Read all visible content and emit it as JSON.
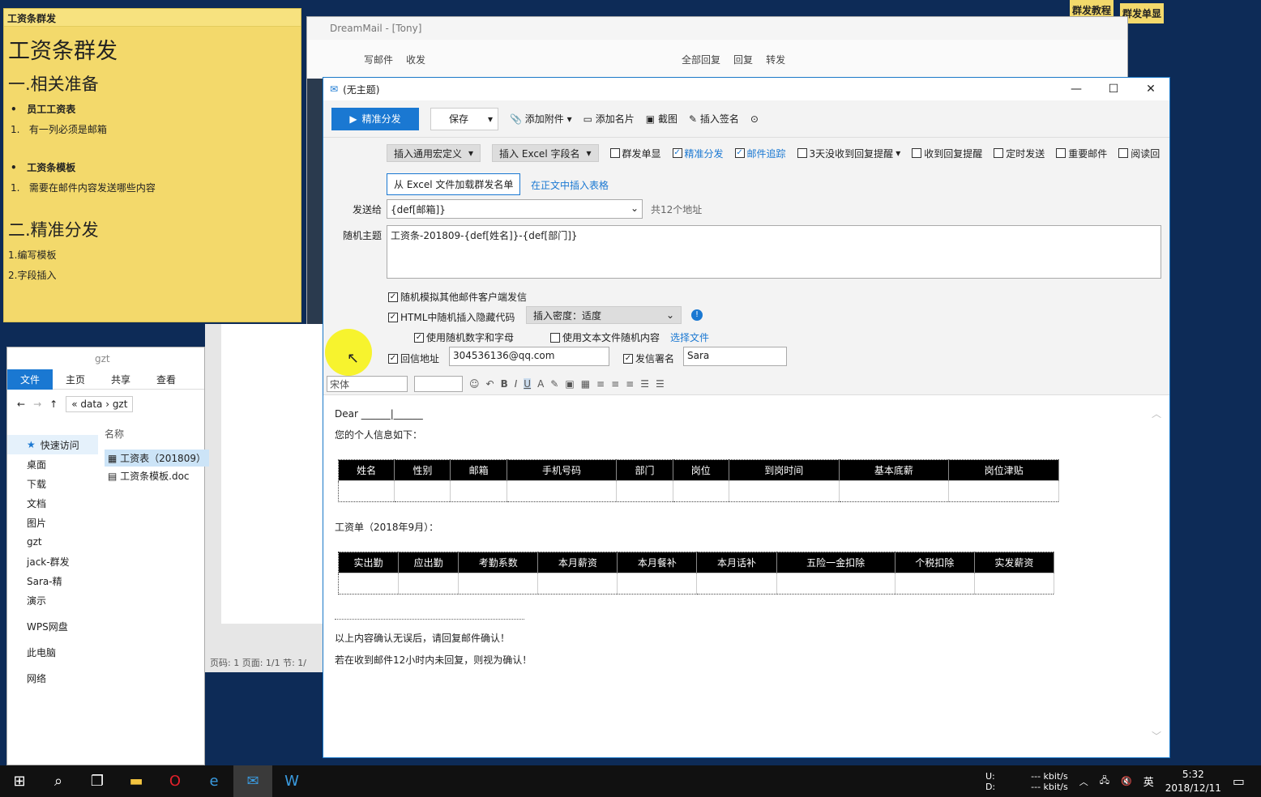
{
  "sticky_note": {
    "bar_title": "工资条群发",
    "heading": "工资条群发",
    "section1": "一.相关准备",
    "items1": [
      "员工工资表",
      "有一列必须是邮箱",
      "工资条模板",
      "需要在邮件内容发送哪些内容"
    ],
    "section2": "二.精准分发",
    "items2": [
      "1.编写模板",
      "2.字段插入"
    ]
  },
  "desktop_tags": [
    "群发教程",
    "群发单显"
  ],
  "main_window": {
    "title": "DreamMail - [Tony]",
    "toolbar": [
      "写邮件",
      "收发",
      "全部回复",
      "回复",
      "转发"
    ]
  },
  "compose": {
    "title": "(无主题)",
    "toolbar": {
      "send": "精准分发",
      "save": "保存",
      "attach": "添加附件",
      "card": "添加名片",
      "screenshot": "截图",
      "signature": "插入签名"
    },
    "options": {
      "macro": "插入通用宏定义",
      "excel_field": "插入 Excel 字段名",
      "checkboxes": [
        {
          "label": "群发单显",
          "checked": false
        },
        {
          "label": "精准分发",
          "checked": true
        },
        {
          "label": "邮件追踪",
          "checked": true
        },
        {
          "label": "3天没收到回复提醒",
          "checked": false
        },
        {
          "label": "收到回复提醒",
          "checked": false
        },
        {
          "label": "定时发送",
          "checked": false
        },
        {
          "label": "重要邮件",
          "checked": false
        },
        {
          "label": "阅读回",
          "checked": false
        }
      ],
      "load_excel": "从 Excel 文件加载群发名单",
      "insert_table": "在正文中插入表格"
    },
    "to_label": "发送给",
    "to_value": "{def[邮箱]}",
    "to_count": "共12个地址",
    "subject_label": "随机主题",
    "subject_value": "工资条-201809-{def[姓名]}-{def[部门]}",
    "random_client": "随机模拟其他邮件客户端发信",
    "html_hidden": "HTML中随机插入隐藏代码",
    "density": "插入密度：适度",
    "random_chars": "使用随机数字和字母",
    "text_file": "使用文本文件随机内容",
    "choose_file": "选择文件",
    "reply_label": "回信地址",
    "reply_value": "304536136@qq.com",
    "sender_label": "发信署名",
    "sender_value": "Sara",
    "font": "宋体"
  },
  "body": {
    "dear": "Dear ______|______",
    "intro": "您的个人信息如下：",
    "table1_headers": [
      "姓名",
      "性别",
      "邮箱",
      "手机号码",
      "部门",
      "岗位",
      "到岗时间",
      "基本底薪",
      "岗位津贴"
    ],
    "salary_title": "工资单（2018年9月）：",
    "table2_headers": [
      "实出勤",
      "应出勤",
      "考勤系数",
      "本月薪资",
      "本月餐补",
      "本月话补",
      "五险一金扣除",
      "个税扣除",
      "实发薪资"
    ],
    "line1": "以上内容确认无误后，请回复邮件确认！",
    "line2": "若在收到邮件12小时内未回复，则视为确认！"
  },
  "explorer": {
    "path_title": "gzt",
    "tabs": [
      "文件",
      "主页",
      "共享",
      "查看"
    ],
    "breadcrumb": [
      "data",
      "gzt"
    ],
    "column": "名称",
    "files": [
      "工资表（201809）",
      "工资条模板.doc"
    ],
    "nav": [
      "快速访问",
      "桌面",
      "下载",
      "文档",
      "图片",
      "gzt",
      "jack-群发",
      "Sara-精",
      "演示",
      "WPS网盘",
      "此电脑",
      "网络"
    ]
  },
  "wps_status": "页码: 1   页面: 1/1   节: 1/",
  "tray": {
    "up": "U:",
    "down": "D:",
    "up_rate": "--- kbit/s",
    "down_rate": "--- kbit/s",
    "ime": "英",
    "time": "5:32",
    "date": "2018/12/11"
  }
}
